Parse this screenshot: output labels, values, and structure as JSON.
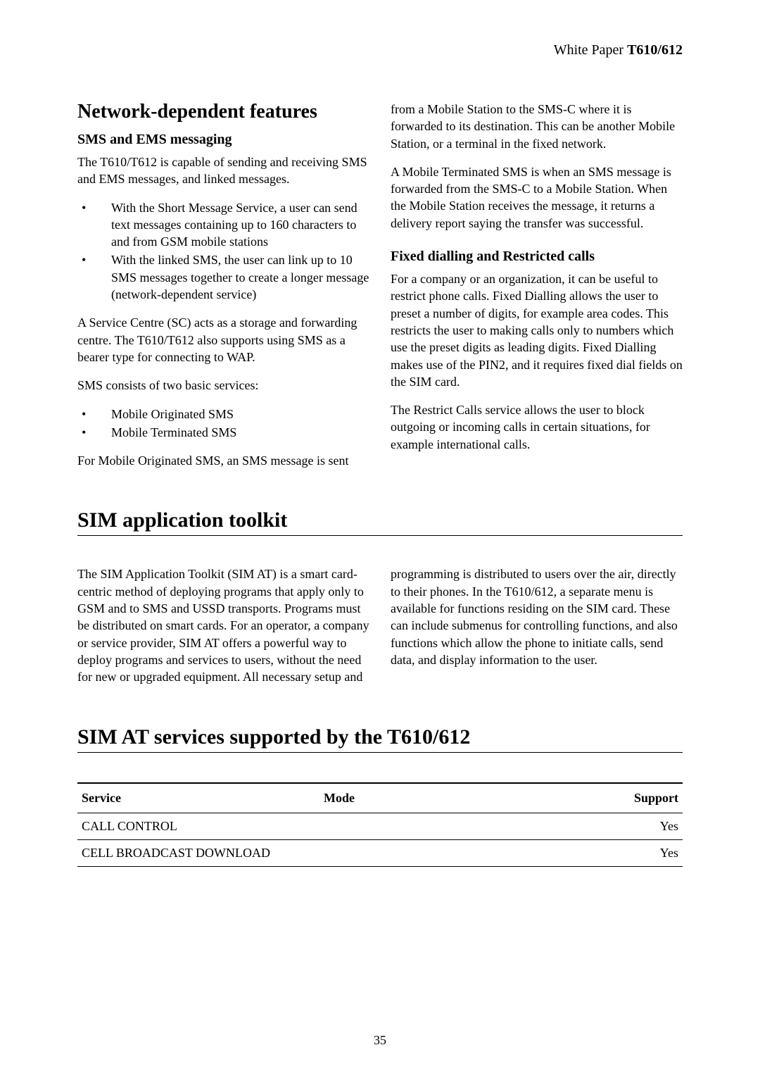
{
  "header": {
    "prefix": "White Paper ",
    "model": "T610/612"
  },
  "section1": {
    "title": "Network-dependent features",
    "sub1": "SMS and EMS messaging",
    "p1": "The T610/T612 is capable of sending and receiving SMS and EMS messages, and linked messages.",
    "li1": "With the Short Message Service, a user can send text messages containing up to 160 characters to and from GSM mobile stations",
    "li2": "With the linked SMS, the user can link up to 10 SMS messages together to create a longer message (network-dependent service)",
    "p2": "A Service Centre (SC) acts as a storage and forwarding centre. The T610/T612 also supports using SMS as a bearer type for connecting to WAP.",
    "p3": "SMS consists of two basic services:",
    "li3": "Mobile Originated SMS",
    "li4": "Mobile Terminated SMS",
    "p4": "For Mobile Originated SMS, an SMS message is sent",
    "p5": "from a Mobile Station to the SMS-C where it is forwarded to its destination. This can be another Mobile Station, or a terminal in the fixed network.",
    "p6": "A Mobile Terminated SMS is when an SMS message is forwarded from the SMS-C to a Mobile Station. When the Mobile Station receives the message, it returns a delivery report saying the transfer was successful.",
    "sub2": "Fixed dialling and Restricted calls",
    "p7": "For a company or an organization, it can be useful to restrict phone calls. Fixed Dialling allows the user to preset a number of digits, for example area codes. This restricts the user to making calls only to numbers which use the preset digits as leading digits. Fixed Dialling makes use of the PIN2, and it requires fixed dial fields on the SIM card.",
    "p8": "The Restrict Calls service allows the user to block outgoing or incoming calls in certain situations, for example international calls."
  },
  "section2": {
    "title": "SIM application toolkit",
    "p1": "The SIM Application Toolkit (SIM AT) is a smart card-centric method of deploying programs that apply only to GSM and to SMS and USSD transports. Programs must be distributed on smart cards. For an operator, a company or service provider, SIM AT offers a powerful way to deploy programs and services to users, without the need for new or upgraded equipment. All necessary setup and",
    "p2": "programming is distributed to users over the air, directly to their phones. In the T610/612, a separate menu is available for functions residing on the SIM card. These can include submenus for controlling functions, and also functions which allow the phone to initiate calls, send data, and display information to the user."
  },
  "section3": {
    "title": "SIM AT services supported by the T610/612",
    "table": {
      "headers": {
        "service": "Service",
        "mode": "Mode",
        "support": "Support"
      },
      "rows": [
        {
          "service": "CALL CONTROL",
          "mode": "",
          "support": "Yes"
        },
        {
          "service": "CELL BROADCAST DOWNLOAD",
          "mode": "",
          "support": "Yes"
        }
      ]
    }
  },
  "pageNumber": "35"
}
